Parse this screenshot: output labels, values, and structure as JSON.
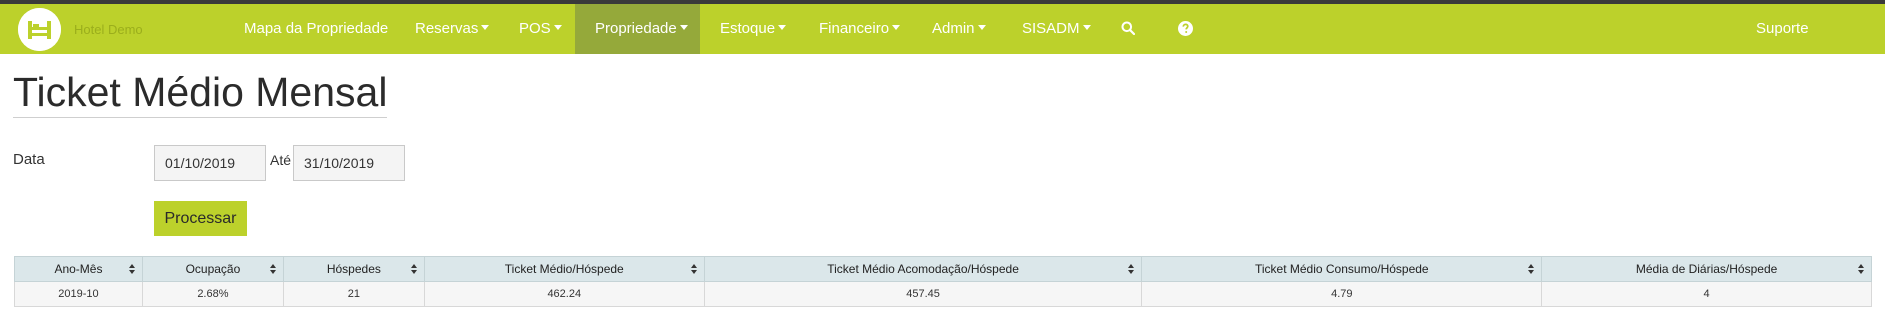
{
  "navbar": {
    "brand": "Hotel Demo",
    "items": [
      {
        "label": "Mapa da Propriedade",
        "dropdown": false
      },
      {
        "label": "Reservas",
        "dropdown": true
      },
      {
        "label": "POS",
        "dropdown": true
      },
      {
        "label": "Propriedade",
        "dropdown": true,
        "active": true
      },
      {
        "label": "Estoque",
        "dropdown": true
      },
      {
        "label": "Financeiro",
        "dropdown": true
      },
      {
        "label": "Admin",
        "dropdown": true
      },
      {
        "label": "SISADM",
        "dropdown": true
      }
    ],
    "support": "Suporte",
    "icons": [
      "bed-logo-icon",
      "search-icon",
      "question-circle-icon"
    ]
  },
  "page": {
    "title": "Ticket Médio Mensal"
  },
  "filters": {
    "date_label": "Data",
    "start_date": "01/10/2019",
    "to_label": "Até",
    "end_date": "31/10/2019",
    "process_button": "Processar"
  },
  "table": {
    "columns": [
      "Ano-Mês",
      "Ocupação",
      "Hóspedes",
      "Ticket Médio/Hóspede",
      "Ticket Médio Acomodação/Hóspede",
      "Ticket Médio Consumo/Hóspede",
      "Média de Diárias/Hóspede"
    ],
    "rows": [
      [
        "2019-10",
        "2.68%",
        "21",
        "462.24",
        "457.45",
        "4.79",
        "4"
      ]
    ]
  },
  "colors": {
    "navbar": "#bcd12b",
    "navbar_active": "#95a93a",
    "table_header": "#dbe7ea",
    "button": "#bcd12b"
  }
}
